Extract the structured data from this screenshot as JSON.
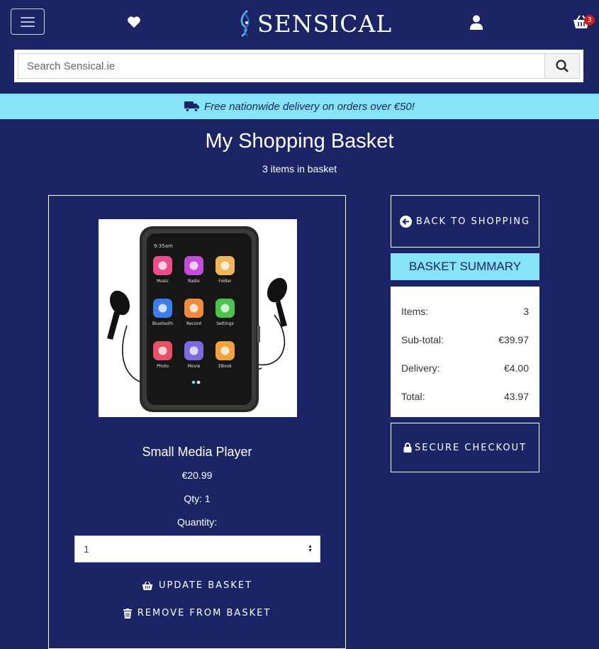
{
  "header": {
    "logo_text": "SENSICAL",
    "cart_count": "3"
  },
  "search": {
    "placeholder": "Search Sensical.ie"
  },
  "banner": {
    "text": "Free nationwide delivery on orders over €50!"
  },
  "page": {
    "title": "My Shopping Basket",
    "items_count": "3 items in basket"
  },
  "product": {
    "name": "Small Media Player",
    "price": "€20.99",
    "qty": "Qty: 1",
    "quantity_label": "Quantity:",
    "quantity_value": "1",
    "update_label": "Update Basket",
    "remove_label": "Remove From Basket",
    "screen": {
      "time": "9:35am",
      "apps": [
        {
          "label": "Music",
          "color": "#ec4c8c"
        },
        {
          "label": "Radio",
          "color": "#c34cd8"
        },
        {
          "label": "Folder",
          "color": "#f0b65a"
        },
        {
          "label": "Bluetooth",
          "color": "#3c7de8"
        },
        {
          "label": "Record",
          "color": "#f08a3c"
        },
        {
          "label": "Settings",
          "color": "#4cc44c"
        },
        {
          "label": "Photo",
          "color": "#e8506a"
        },
        {
          "label": "Movie",
          "color": "#7c6ae0"
        },
        {
          "label": "EBook",
          "color": "#f2a23c"
        }
      ]
    }
  },
  "sidebar": {
    "back_label": "Back to Shopping",
    "summary_title": "Basket Summary",
    "summary": [
      {
        "label": "Items:",
        "value": "3"
      },
      {
        "label": "Sub-total:",
        "value": "€39.97"
      },
      {
        "label": "Delivery:",
        "value": "€4.00"
      },
      {
        "label": "Total:",
        "value": "43.97"
      }
    ],
    "checkout_label": "Secure Checkout"
  },
  "colors": {
    "background": "#1b2566",
    "accent": "#87e3f8",
    "badge": "#c81e1e"
  }
}
